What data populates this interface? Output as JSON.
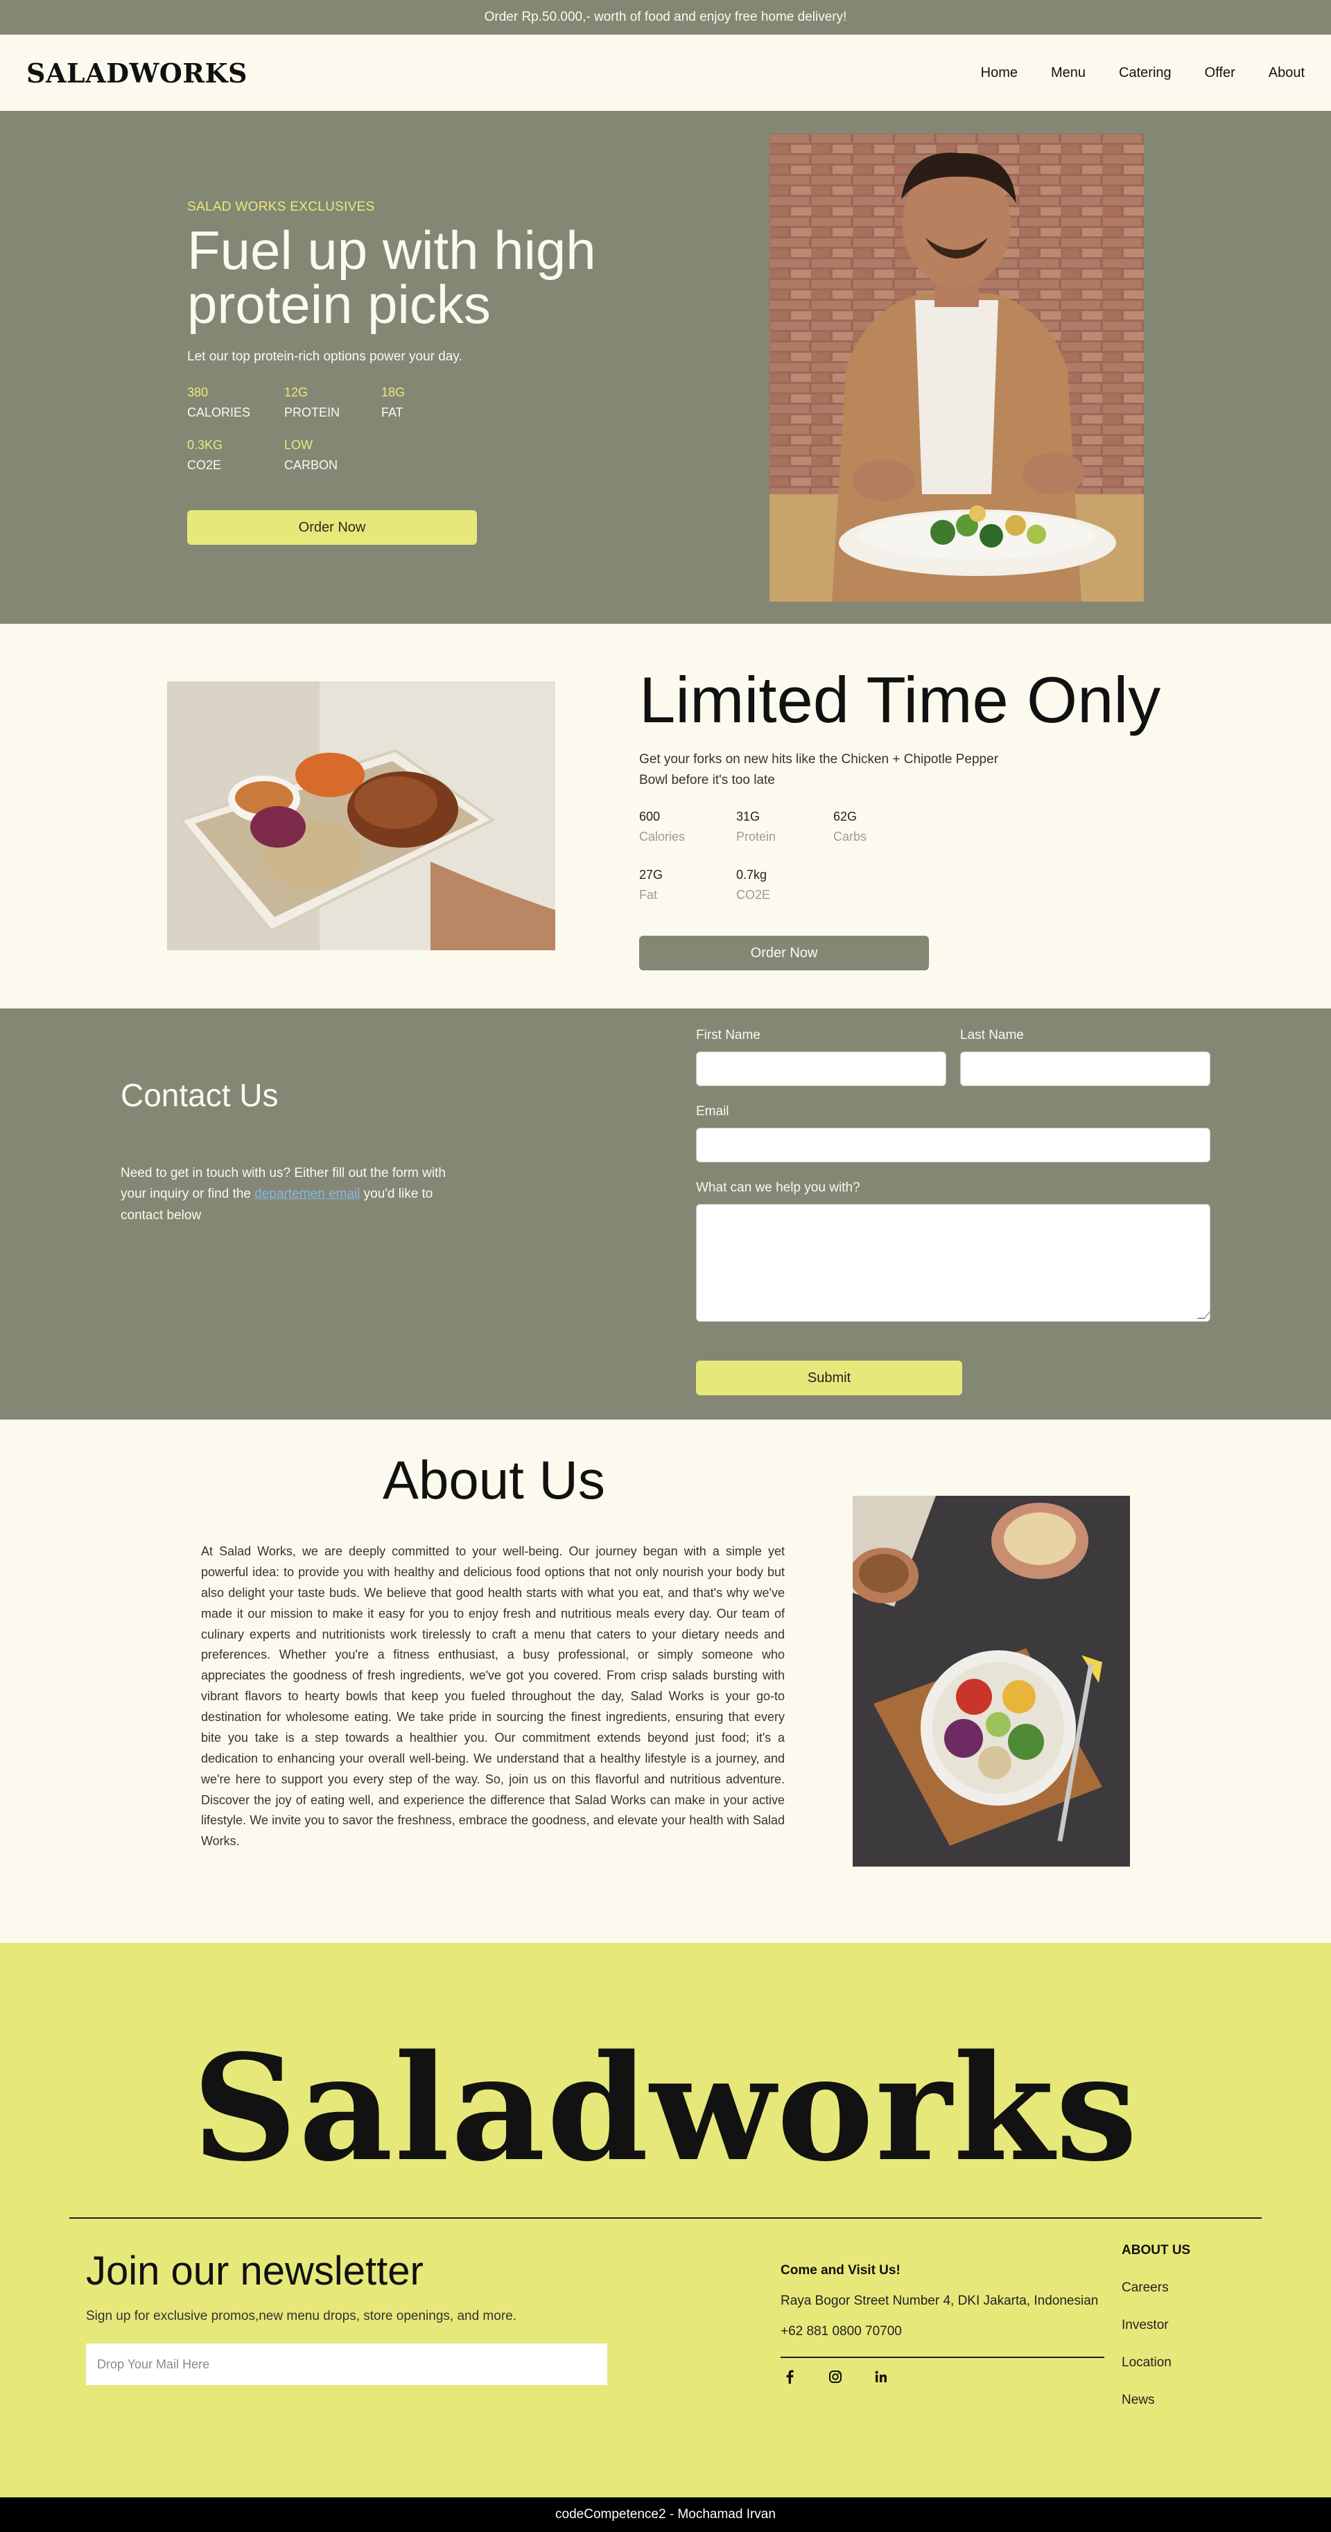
{
  "promo": {
    "text": "Order Rp.50.000,- worth of food and enjoy free home delivery!"
  },
  "nav": {
    "logo": "SALADWORKS",
    "links": [
      "Home",
      "Menu",
      "Catering",
      "Offer",
      "About"
    ]
  },
  "hero": {
    "eyebrow": "SALAD WORKS EXCLUSIVES",
    "title": "Fuel up with high protein picks",
    "subtitle": "Let our top protein-rich options power your day.",
    "stats": [
      {
        "value": "380",
        "label": "CALORIES"
      },
      {
        "value": "12G",
        "label": "PROTEIN"
      },
      {
        "value": "18G",
        "label": "FAT"
      },
      {
        "value": "0.3KG",
        "label": "CO2E"
      },
      {
        "value": "LOW",
        "label": "CARBON"
      }
    ],
    "button": "Order Now"
  },
  "limited": {
    "title": "Limited Time Only",
    "subtitle": "Get your forks on new hits like the Chicken + Chipotle Pepper Bowl before it's too late",
    "stats": [
      {
        "value": "600",
        "label": "Calories"
      },
      {
        "value": "31G",
        "label": "Protein"
      },
      {
        "value": "62G",
        "label": "Carbs"
      },
      {
        "value": "27G",
        "label": "Fat"
      },
      {
        "value": "0.7kg",
        "label": "CO2E"
      }
    ],
    "button": "Order Now"
  },
  "contact": {
    "title": "Contact Us",
    "text_before": "Need to get in touch with us? Either fill out the form with your inquiry or find the ",
    "link": "departemen email",
    "text_after": " you'd like to contact below",
    "first_name_label": "First Name",
    "last_name_label": "Last Name",
    "email_label": "Email",
    "message_label": "What can we help you with?",
    "submit": "Submit"
  },
  "about": {
    "title": "About Us",
    "text": "At Salad Works, we are deeply committed to your well-being. Our journey began with a simple yet powerful idea: to provide you with healthy and delicious food options that not only nourish your body but also delight your taste buds. We believe that good health starts with what you eat, and that's why we've made it our mission to make it easy for you to enjoy fresh and nutritious meals every day. Our team of culinary experts and nutritionists work tirelessly to craft a menu that caters to your dietary needs and preferences. Whether you're a fitness enthusiast, a busy professional, or simply someone who appreciates the goodness of fresh ingredients, we've got you covered. From crisp salads bursting with vibrant flavors to hearty bowls that keep you fueled throughout the day, Salad Works is your go-to destination for wholesome eating. We take pride in sourcing the finest ingredients, ensuring that every bite you take is a step towards a healthier you. Our commitment extends beyond just food; it's a dedication to enhancing your overall well-being. We understand that a healthy lifestyle is a journey, and we're here to support you every step of the way. So, join us on this flavorful and nutritious adventure. Discover the joy of eating well, and experience the difference that Salad Works can make in your active lifestyle. We invite you to savor the freshness, embrace the goodness, and elevate your health with Salad Works."
  },
  "footer": {
    "brand": "Saladworks",
    "newsletter_title": "Join our newsletter",
    "newsletter_sub": "Sign up for exclusive promos,new menu drops, store openings, and more.",
    "newsletter_placeholder": "Drop Your Mail Here",
    "visit_title": "Come and Visit Us!",
    "address": "Raya Bogor Street Number 4, DKI Jakarta, Indonesian",
    "phone": "+62 881 0800 70700",
    "socials": [
      "facebook-icon",
      "instagram-icon",
      "linkedin-icon"
    ],
    "about_title": "ABOUT US",
    "about_links": [
      "Careers",
      "Investor",
      "Location",
      "News"
    ]
  },
  "bottom": {
    "text": "codeCompetence2 - Mochamad Irvan"
  },
  "colors": {
    "olive": "#848774",
    "cream": "#fcfaee",
    "lime": "#e6e97a",
    "black": "#000000"
  }
}
